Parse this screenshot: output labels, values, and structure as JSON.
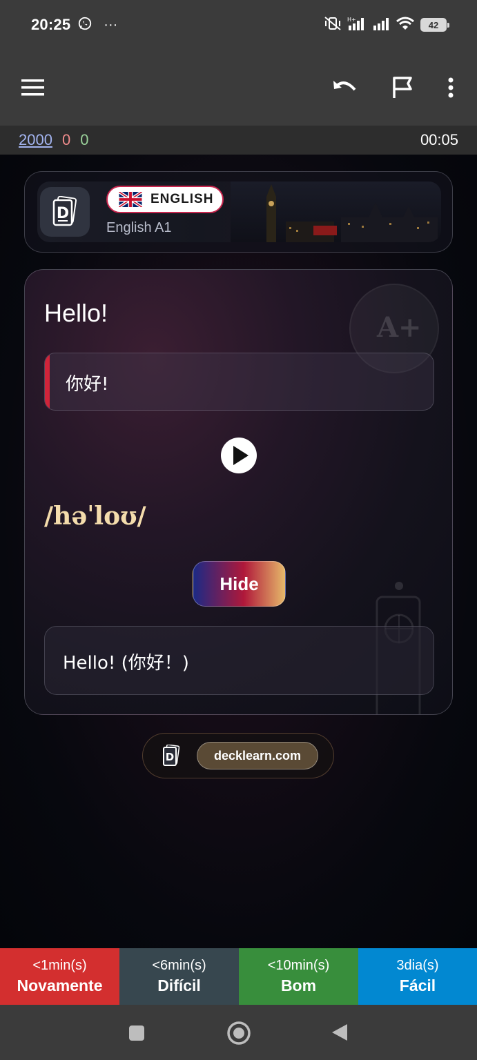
{
  "status_bar": {
    "time": "20:25",
    "more": "···",
    "battery": "42"
  },
  "toolbar": {
    "menu_icon": "menu-icon",
    "undo_icon": "undo-icon",
    "flag_icon": "flag-icon",
    "more_icon": "more-vert-icon"
  },
  "stats": {
    "total": "2000",
    "red_count": "0",
    "green_count": "0",
    "timer": "00:05"
  },
  "header": {
    "language": "ENGLISH",
    "deck": "English A1"
  },
  "card": {
    "front": "Hello!",
    "translation": "你好!",
    "phonetic": "/həˈloʊ/",
    "hide_label": "Hide",
    "example": "Hello! (你好！)",
    "badge": "A+"
  },
  "footer": {
    "site": "decklearn.com"
  },
  "answers": [
    {
      "time": "<1min(s)",
      "label": "Novamente",
      "color": "#d32f2f"
    },
    {
      "time": "<6min(s)",
      "label": "Difícil",
      "color": "#37474f"
    },
    {
      "time": "<10min(s)",
      "label": "Bom",
      "color": "#388e3c"
    },
    {
      "time": "3dia(s)",
      "label": "Fácil",
      "color": "#0288d1"
    }
  ]
}
